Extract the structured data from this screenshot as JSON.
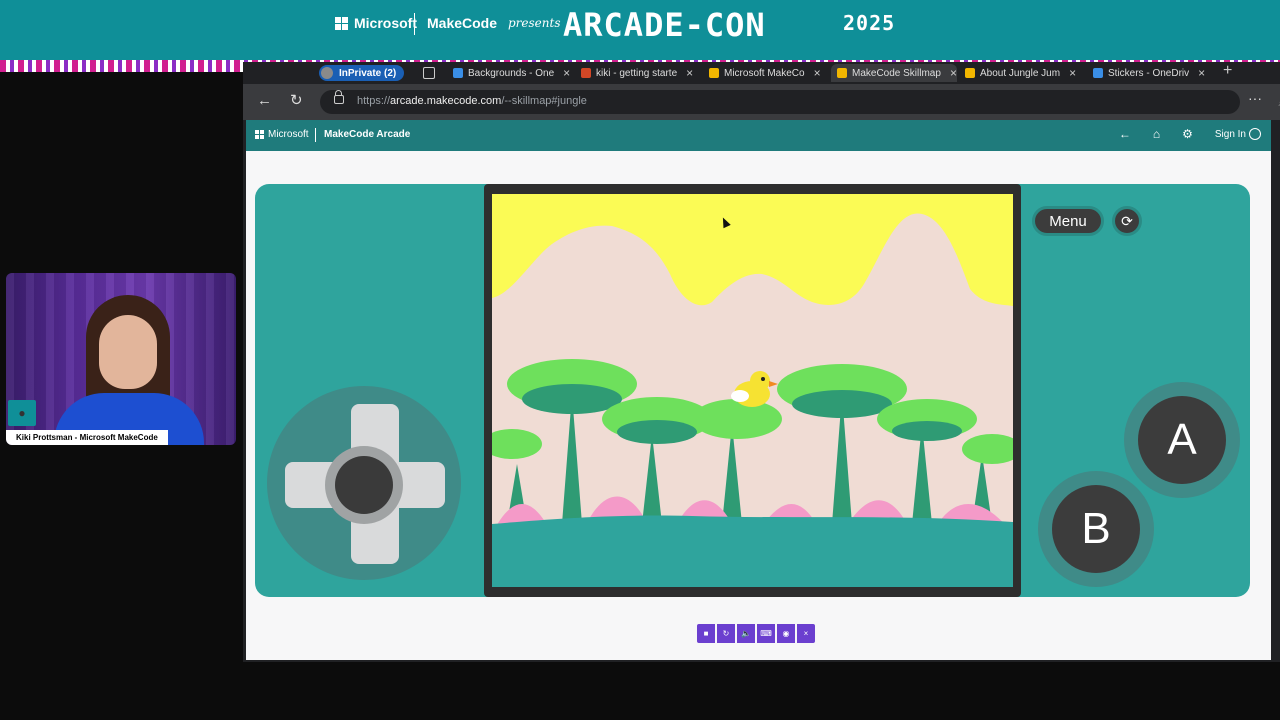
{
  "banner": {
    "ms_label": "Microsoft",
    "makecode_label": "MakeCode",
    "presents": "presents",
    "title": "ARCADE-CON",
    "year": "2025"
  },
  "webcam": {
    "caption": "Kiki Prottsman - Microsoft MakeCode"
  },
  "browser": {
    "inprivate_label": "InPrivate (2)",
    "tabs": [
      {
        "label": "Backgrounds - One",
        "icon": "onedrive-icon",
        "color": "#3a8ee6"
      },
      {
        "label": "kiki - getting starte",
        "icon": "powerpoint-icon",
        "color": "#d24726"
      },
      {
        "label": "Microsoft MakeCo",
        "icon": "microsoft-icon",
        "color": "#f2b600"
      },
      {
        "label": "MakeCode Skillmap",
        "icon": "microsoft-icon",
        "color": "#f2b600"
      },
      {
        "label": "About Jungle Jum",
        "icon": "microsoft-icon",
        "color": "#f2b600"
      },
      {
        "label": "Stickers - OneDriv",
        "icon": "onedrive-icon",
        "color": "#3a8ee6"
      }
    ],
    "url_prefix": "https://",
    "url_domain": "arcade.makecode.com",
    "url_path": "/--skillmap#jungle"
  },
  "makecode": {
    "ms_label": "Microsoft",
    "title": "MakeCode Arcade",
    "signin": "Sign In"
  },
  "game": {
    "menu_label": "Menu",
    "a_label": "A",
    "b_label": "B"
  },
  "colors": {
    "sky": "#fbfb55",
    "hills": "#ead2ca",
    "teal": "#2fa49d",
    "palm_green": "#6ee05c",
    "palm_dark": "#2f9b74",
    "pink": "#f49ac8",
    "duck": "#f6e232"
  }
}
